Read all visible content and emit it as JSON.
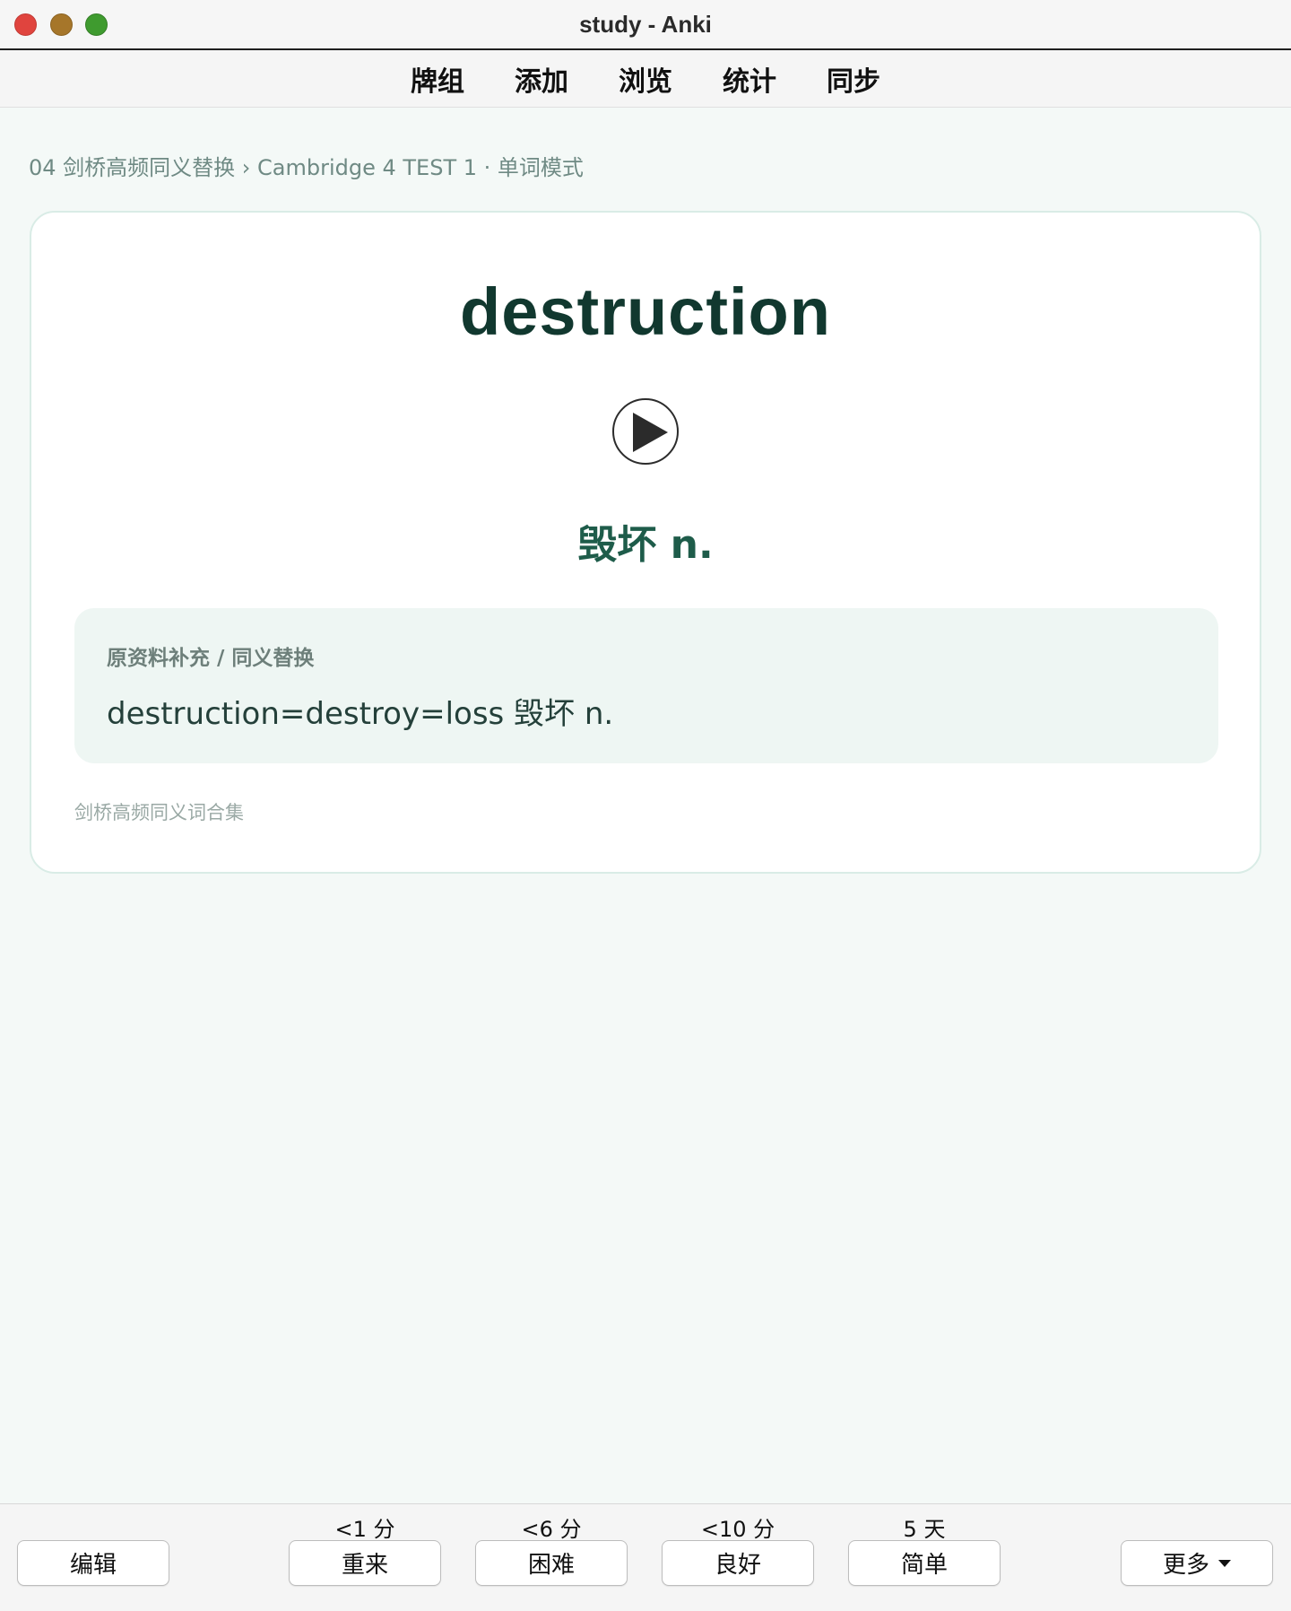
{
  "window": {
    "title": "study - Anki"
  },
  "toolbar": {
    "items": [
      "牌组",
      "添加",
      "浏览",
      "统计",
      "同步"
    ]
  },
  "breadcrumb": "04 剑桥高频同义替换 › Cambridge 4 TEST 1 · 单词模式",
  "card": {
    "word": "destruction",
    "meaning": "毁坏 n.",
    "note_label": "原资料补充 / 同义替换",
    "note_text": "destruction=destroy=loss 毁坏 n.",
    "source": "剑桥高频同义词合集"
  },
  "bottom": {
    "edit_label": "编辑",
    "answers": [
      {
        "interval": "<1 分",
        "label": "重来"
      },
      {
        "interval": "<6 分",
        "label": "困难"
      },
      {
        "interval": "<10 分",
        "label": "良好"
      },
      {
        "interval": "5 天",
        "label": "简单"
      }
    ],
    "more_label": "更多"
  },
  "colors": {
    "word": "#11382f",
    "meaning": "#1e5c4a",
    "note_bg": "#eef6f3",
    "page_bg": "#f4f9f7"
  }
}
